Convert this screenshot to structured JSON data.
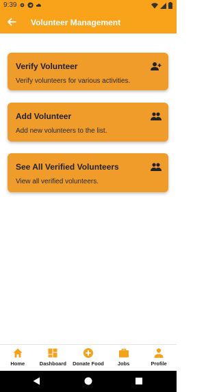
{
  "status_bar": {
    "time": "9:39"
  },
  "app_bar": {
    "title": "Volunteer Management",
    "back_icon": "arrow-left-icon"
  },
  "cards": [
    {
      "title": "Verify Volunteer",
      "description": "Verify volunteers for various activities.",
      "icon": "person-add-icon"
    },
    {
      "title": "Add Volunteer",
      "description": "Add new volunteers to the list.",
      "icon": "people-icon"
    },
    {
      "title": "See All Verified Volunteers",
      "description": "View all verified volunteers.",
      "icon": "people-icon"
    }
  ],
  "bottom_nav": [
    {
      "label": "Home",
      "icon": "home-icon"
    },
    {
      "label": "Dashboard",
      "icon": "dashboard-icon"
    },
    {
      "label": "Donate Food",
      "icon": "add-circle-icon"
    },
    {
      "label": "Jobs",
      "icon": "briefcase-icon"
    },
    {
      "label": "Profile",
      "icon": "person-icon"
    }
  ],
  "colors": {
    "primary": "#f9a31b",
    "card": "#f09c2b",
    "accent_icon": "#f5a21b"
  }
}
